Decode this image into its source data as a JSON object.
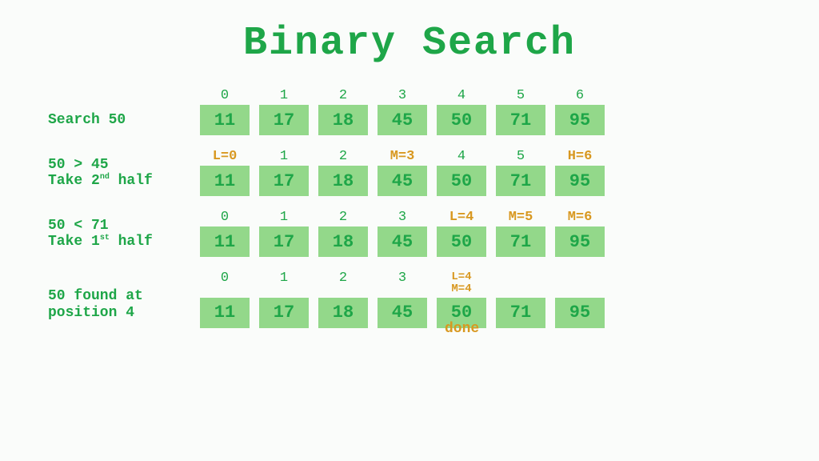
{
  "title": "Binary Search",
  "array": [
    "11",
    "17",
    "18",
    "45",
    "50",
    "71",
    "95"
  ],
  "rows": [
    {
      "label_html": "Search 50",
      "indices": [
        {
          "text": "0",
          "hl": false
        },
        {
          "text": "1",
          "hl": false
        },
        {
          "text": "2",
          "hl": false
        },
        {
          "text": "3",
          "hl": false
        },
        {
          "text": "4",
          "hl": false
        },
        {
          "text": "5",
          "hl": false
        },
        {
          "text": "6",
          "hl": false
        }
      ]
    },
    {
      "label_html": "50 > 45\nTake 2<sup>nd</sup> half",
      "indices": [
        {
          "text": "L=0",
          "hl": true
        },
        {
          "text": "1",
          "hl": false
        },
        {
          "text": "2",
          "hl": false
        },
        {
          "text": "M=3",
          "hl": true
        },
        {
          "text": "4",
          "hl": false
        },
        {
          "text": "5",
          "hl": false
        },
        {
          "text": "H=6",
          "hl": true
        }
      ]
    },
    {
      "label_html": "50 < 71\nTake 1<sup>st</sup> half",
      "indices": [
        {
          "text": "0",
          "hl": false
        },
        {
          "text": "1",
          "hl": false
        },
        {
          "text": "2",
          "hl": false
        },
        {
          "text": "3",
          "hl": false
        },
        {
          "text": "L=4",
          "hl": true
        },
        {
          "text": "M=5",
          "hl": true
        },
        {
          "text": "M=6",
          "hl": true
        }
      ]
    },
    {
      "label_html": "50 found at\nposition 4",
      "indices": [
        {
          "text": "0",
          "hl": false
        },
        {
          "text": "1",
          "hl": false
        },
        {
          "text": "2",
          "hl": false
        },
        {
          "text": "3",
          "hl": false
        },
        {
          "text": "L=4\nM=4",
          "hl": true,
          "stack": true
        },
        {
          "text": "",
          "hl": false
        },
        {
          "text": "",
          "hl": false
        }
      ],
      "done_note": {
        "text": "done",
        "col": 4
      }
    }
  ]
}
